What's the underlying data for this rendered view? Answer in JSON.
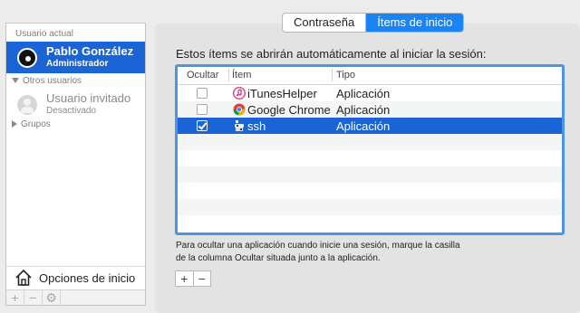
{
  "sidebar": {
    "current_user_heading": "Usuario actual",
    "current_user": {
      "name": "Pablo González",
      "role": "Administrador"
    },
    "other_users_heading": "Otros usuarios",
    "guest_user": {
      "name": "Usuario invitado",
      "status": "Desactivado"
    },
    "groups_label": "Grupos",
    "login_options_label": "Opciones de inicio",
    "toolbar": {
      "add": "+",
      "remove": "−",
      "settings": "⚙"
    }
  },
  "tabs": [
    {
      "label": "Contraseña",
      "active": false
    },
    {
      "label": "Ítems de inicio",
      "active": true
    }
  ],
  "description": "Estos ítems se abrirán automáticamente al iniciar la sesión:",
  "table": {
    "headers": {
      "hide": "Ocultar",
      "item": "Ítem",
      "type": "Tipo"
    },
    "rows": [
      {
        "hide": false,
        "item": "iTunesHelper",
        "type": "Aplicación",
        "icon": "itunes-icon"
      },
      {
        "hide": false,
        "item": "Google Chrome",
        "type": "Aplicación",
        "icon": "chrome-icon"
      },
      {
        "hide": true,
        "item": "ssh",
        "type": "Aplicación",
        "icon": "ssh-app-icon"
      }
    ]
  },
  "note_line1": "Para ocultar una aplicación cuando inicie una sesión, marque la casilla",
  "note_line2": "de la columna Ocultar situada junto a la aplicación.",
  "buttons": {
    "add": "+",
    "remove": "−"
  },
  "colors": {
    "selection": "#1a64d6",
    "accent": "#1a84f5"
  }
}
